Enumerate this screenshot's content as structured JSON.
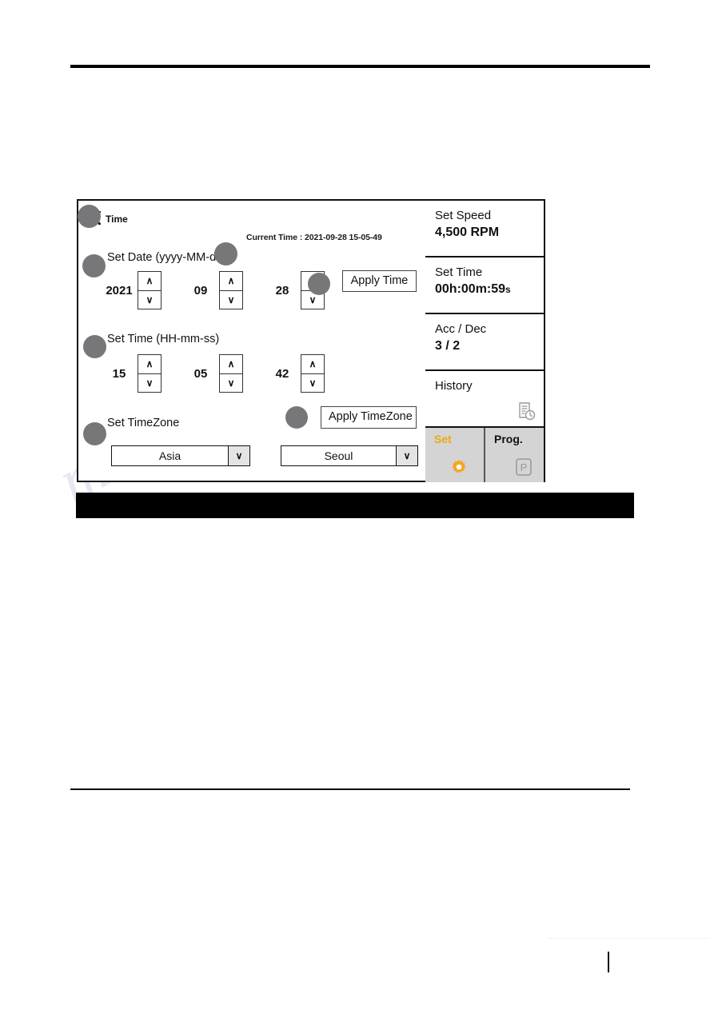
{
  "screen": {
    "title": "Time",
    "back_icon": "‹",
    "current_time_label": "Current Time : 2021-09-28 15-05-49",
    "sections": {
      "date_label": "Set Date (yyyy-MM-dd)",
      "time_label": "Set Time (HH-mm-ss)",
      "timezone_label": "Set TimeZone"
    },
    "date": {
      "year": "2021",
      "month": "09",
      "day": "28"
    },
    "time": {
      "hour": "15",
      "minute": "05",
      "second": "42"
    },
    "timezone": {
      "region": "Asia",
      "city": "Seoul"
    },
    "buttons": {
      "apply_time": "Apply Time",
      "apply_timezone": "Apply TimeZone"
    },
    "spinner": {
      "up_glyph": "∧",
      "down_glyph": "∨",
      "dropdown_glyph": "∨"
    }
  },
  "sidebar": {
    "tiles": [
      {
        "label": "Set Speed",
        "value": "4,500 RPM",
        "icon": ""
      },
      {
        "label": "Set Time",
        "value_main": "00h:00m:59",
        "value_unit": "s",
        "icon": ""
      },
      {
        "label": "Acc / Dec",
        "value": "3 / 2",
        "icon": ""
      },
      {
        "label": "History",
        "value": "",
        "icon": "history-document-clock-icon"
      }
    ],
    "bottom_buttons": [
      {
        "label": "Set",
        "icon": "gear-icon",
        "color": "#f0a80f",
        "active": true
      },
      {
        "label": "Prog.",
        "icon": "p-box-icon",
        "color": "#111111",
        "active": false
      }
    ]
  },
  "watermark": {
    "line1": "manualshive.com"
  },
  "colors": {
    "accent_orange": "#f0a80f",
    "panel_gray": "#d4d4d4",
    "marker_gray": "#77777a",
    "border_black": "#111111"
  }
}
